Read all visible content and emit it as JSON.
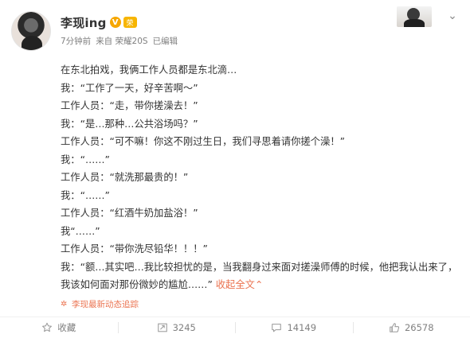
{
  "user": {
    "name": "李现ing",
    "badge_v": "V",
    "badge_vip": "荣"
  },
  "meta": {
    "time": "7分钟前",
    "source": "来自 荣耀20S",
    "edited": "已编辑"
  },
  "post": {
    "lines": [
      "在东北拍戏，我俩工作人员都是东北滴…",
      "我：“工作了一天，好辛苦啊～”",
      "工作人员：“走，带你搓澡去！”",
      "我：“是…那种…公共浴场吗？”",
      "工作人员：“可不嘛！你这不刚过生日，我们寻思着请你搓个澡！”",
      "我：“……”",
      "工作人员：“就洗那最贵的！”",
      "我：“……”",
      "工作人员：“红酒牛奶加盐浴！”",
      "我“……”",
      "工作人员：“带你洗尽铅华！！！”"
    ],
    "last_line": "我：“额…其实吧…我比较担忧的是，当我翻身过来面对搓澡师傅的时候，他把我认出来了，我该如何面对那份微妙的尴尬……”",
    "expand_label": "收起全文",
    "expand_arrow": "⌃"
  },
  "source_link": {
    "label": "李现最新动态追踪",
    "icon": "sparkle-icon"
  },
  "actions": {
    "favorite": {
      "label": "收藏",
      "icon": "star-icon"
    },
    "repost": {
      "count": "3245",
      "icon": "repost-icon"
    },
    "comment": {
      "count": "14149",
      "icon": "comment-icon"
    },
    "like": {
      "count": "26578",
      "icon": "thumbs-up-icon"
    }
  },
  "colors": {
    "text": "#333333",
    "meta": "#808080",
    "accent": "#eb7350",
    "badge": "#f6a700"
  }
}
